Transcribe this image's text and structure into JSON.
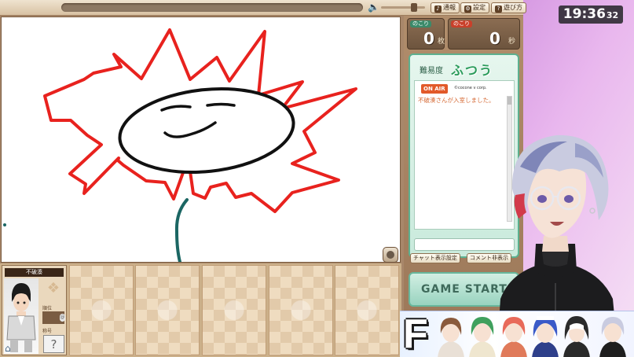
{
  "toolbar": {
    "buttons": [
      {
        "icon": "♪",
        "label": "通報"
      },
      {
        "icon": "⚙",
        "label": "設定"
      },
      {
        "icon": "?",
        "label": "遊び方"
      }
    ]
  },
  "counts": {
    "cards": {
      "label": "のこり",
      "value": "0",
      "unit": "枚"
    },
    "seconds": {
      "label": "のこり",
      "value": "0",
      "unit": "秒"
    }
  },
  "difficulty": {
    "label": "難易度",
    "value": "ふつう"
  },
  "chat": {
    "badge": "ON AIR",
    "copyright": "©cocone v corp.",
    "messages": [
      "不破湊さんが入室しました。"
    ]
  },
  "panel_buttons": {
    "chat_settings": "チャット表示設定",
    "comment_hide": "コメント非表示"
  },
  "game_start": "GAME START",
  "player": {
    "name": "不破湊",
    "rank_label": "順位",
    "path_label": "称号",
    "mystery": "?"
  },
  "clock": {
    "time": "19:36",
    "seconds": "32"
  },
  "members_letter": "F",
  "colors": {
    "petal": "#e8221e",
    "face": "#111111",
    "stem": "#1b6663",
    "panel_green": "#5cb08f"
  }
}
